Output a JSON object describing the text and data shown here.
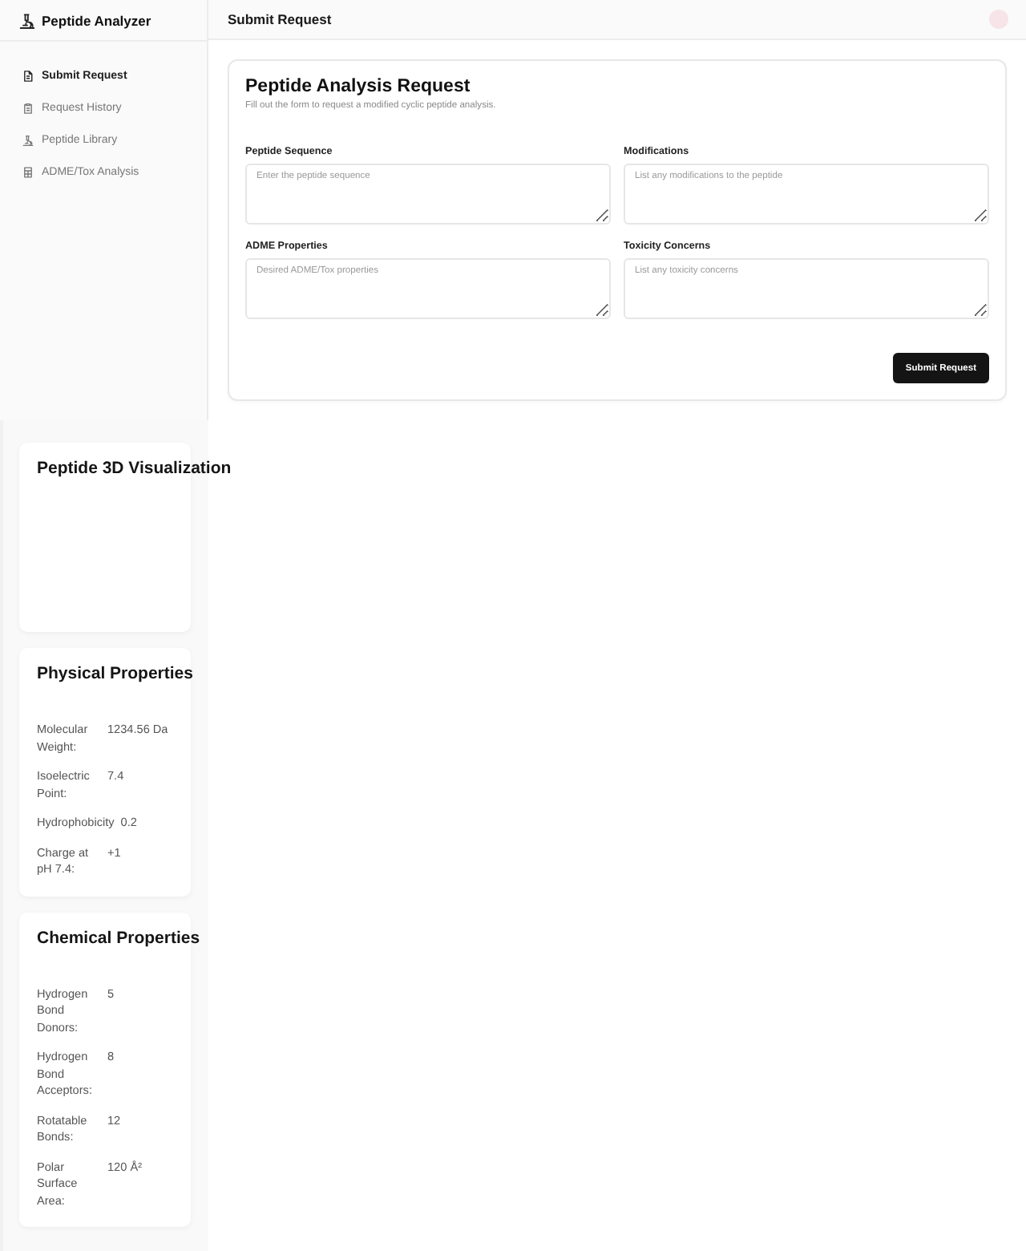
{
  "sidebar": {
    "app_title": "Peptide Analyzer",
    "items": [
      {
        "label": "Submit Request",
        "selected": true
      },
      {
        "label": "Request History",
        "selected": false
      },
      {
        "label": "Peptide Library",
        "selected": false
      },
      {
        "label": "ADME/Tox Analysis",
        "selected": false
      }
    ]
  },
  "header": {
    "title": "Submit Request"
  },
  "form": {
    "title": "Peptide Analysis Request",
    "subtitle": "Fill out the form to request a modified cyclic peptide analysis.",
    "fields": [
      {
        "label": "Peptide Sequence",
        "placeholder": "Enter the peptide sequence"
      },
      {
        "label": "Modifications",
        "placeholder": "List any modifications to the peptide"
      },
      {
        "label": "ADME Properties",
        "placeholder": "Desired ADME/Tox properties"
      },
      {
        "label": "Toxicity Concerns",
        "placeholder": "List any toxicity concerns"
      }
    ],
    "submit_button": "Submit Request"
  },
  "panels": [
    {
      "title": "Peptide 3D Visualization"
    },
    {
      "title": "Physical Properties",
      "rows": [
        {
          "label": "Molecular Weight:",
          "value": "1234.56 Da"
        },
        {
          "label": "Isoelectric Point:",
          "value": "7.4"
        },
        {
          "label": "Hydrophobicity",
          "value": "0.2"
        },
        {
          "label": "Charge at pH 7.4:",
          "value": "+1"
        }
      ]
    },
    {
      "title": "Chemical Properties",
      "rows": [
        {
          "label": "Hydrogen Bond Donors:",
          "value": "5"
        },
        {
          "label": "Hydrogen Bond Acceptors:",
          "value": "8"
        },
        {
          "label": "Rotatable Bonds:",
          "value": "12"
        },
        {
          "label": "Polar Surface Area:",
          "value": "120 Å²"
        }
      ]
    }
  ]
}
